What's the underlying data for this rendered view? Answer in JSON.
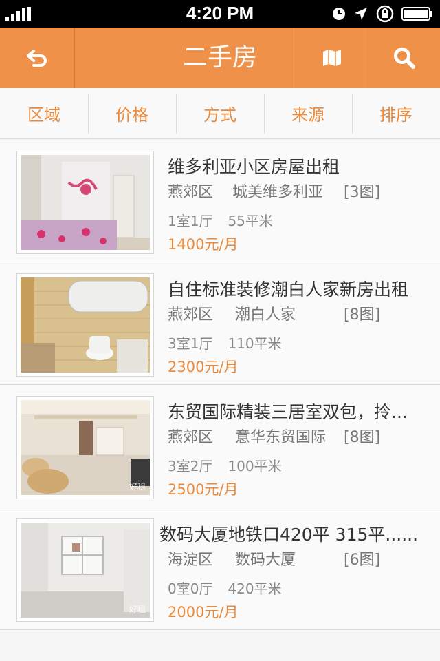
{
  "status_bar": {
    "time": "4:20 PM"
  },
  "header": {
    "title": "二手房",
    "back_icon": "back-arrow-icon",
    "map_icon": "map-icon",
    "search_icon": "search-icon",
    "background": "#f0914a"
  },
  "filters": [
    {
      "label": "区域"
    },
    {
      "label": "价格"
    },
    {
      "label": "方式"
    },
    {
      "label": "来源"
    },
    {
      "label": "排序"
    }
  ],
  "listings": [
    {
      "title": "维多利亚小区房屋出租",
      "district": "燕郊区",
      "community": "城美维多利亚",
      "photos": "[3图]",
      "rooms": "1室1厅",
      "area": "55平米",
      "price": "1400元/月"
    },
    {
      "title": "自住标准装修潮白人家新房出租",
      "district": "燕郊区",
      "community": "潮白人家",
      "photos": "[8图]",
      "rooms": "3室1厅",
      "area": "110平米",
      "price": "2300元/月"
    },
    {
      "title": "东贸国际精装三居室双包，拎...",
      "district": "燕郊区",
      "community": "意华东贸国际",
      "photos": "[8图]",
      "rooms": "3室2厅",
      "area": "100平米",
      "price": "2500元/月",
      "watermark": "好租"
    },
    {
      "title": "数码大厦地铁口420平  315平......",
      "district": "海淀区",
      "community": "数码大厦",
      "photos": "[6图]",
      "rooms": "0室0厅",
      "area": "420平米",
      "price": "2000元/月",
      "watermark": "好租"
    }
  ],
  "colors": {
    "accent": "#ec8a3c",
    "title_text": "#333333",
    "meta_text": "#777777"
  }
}
